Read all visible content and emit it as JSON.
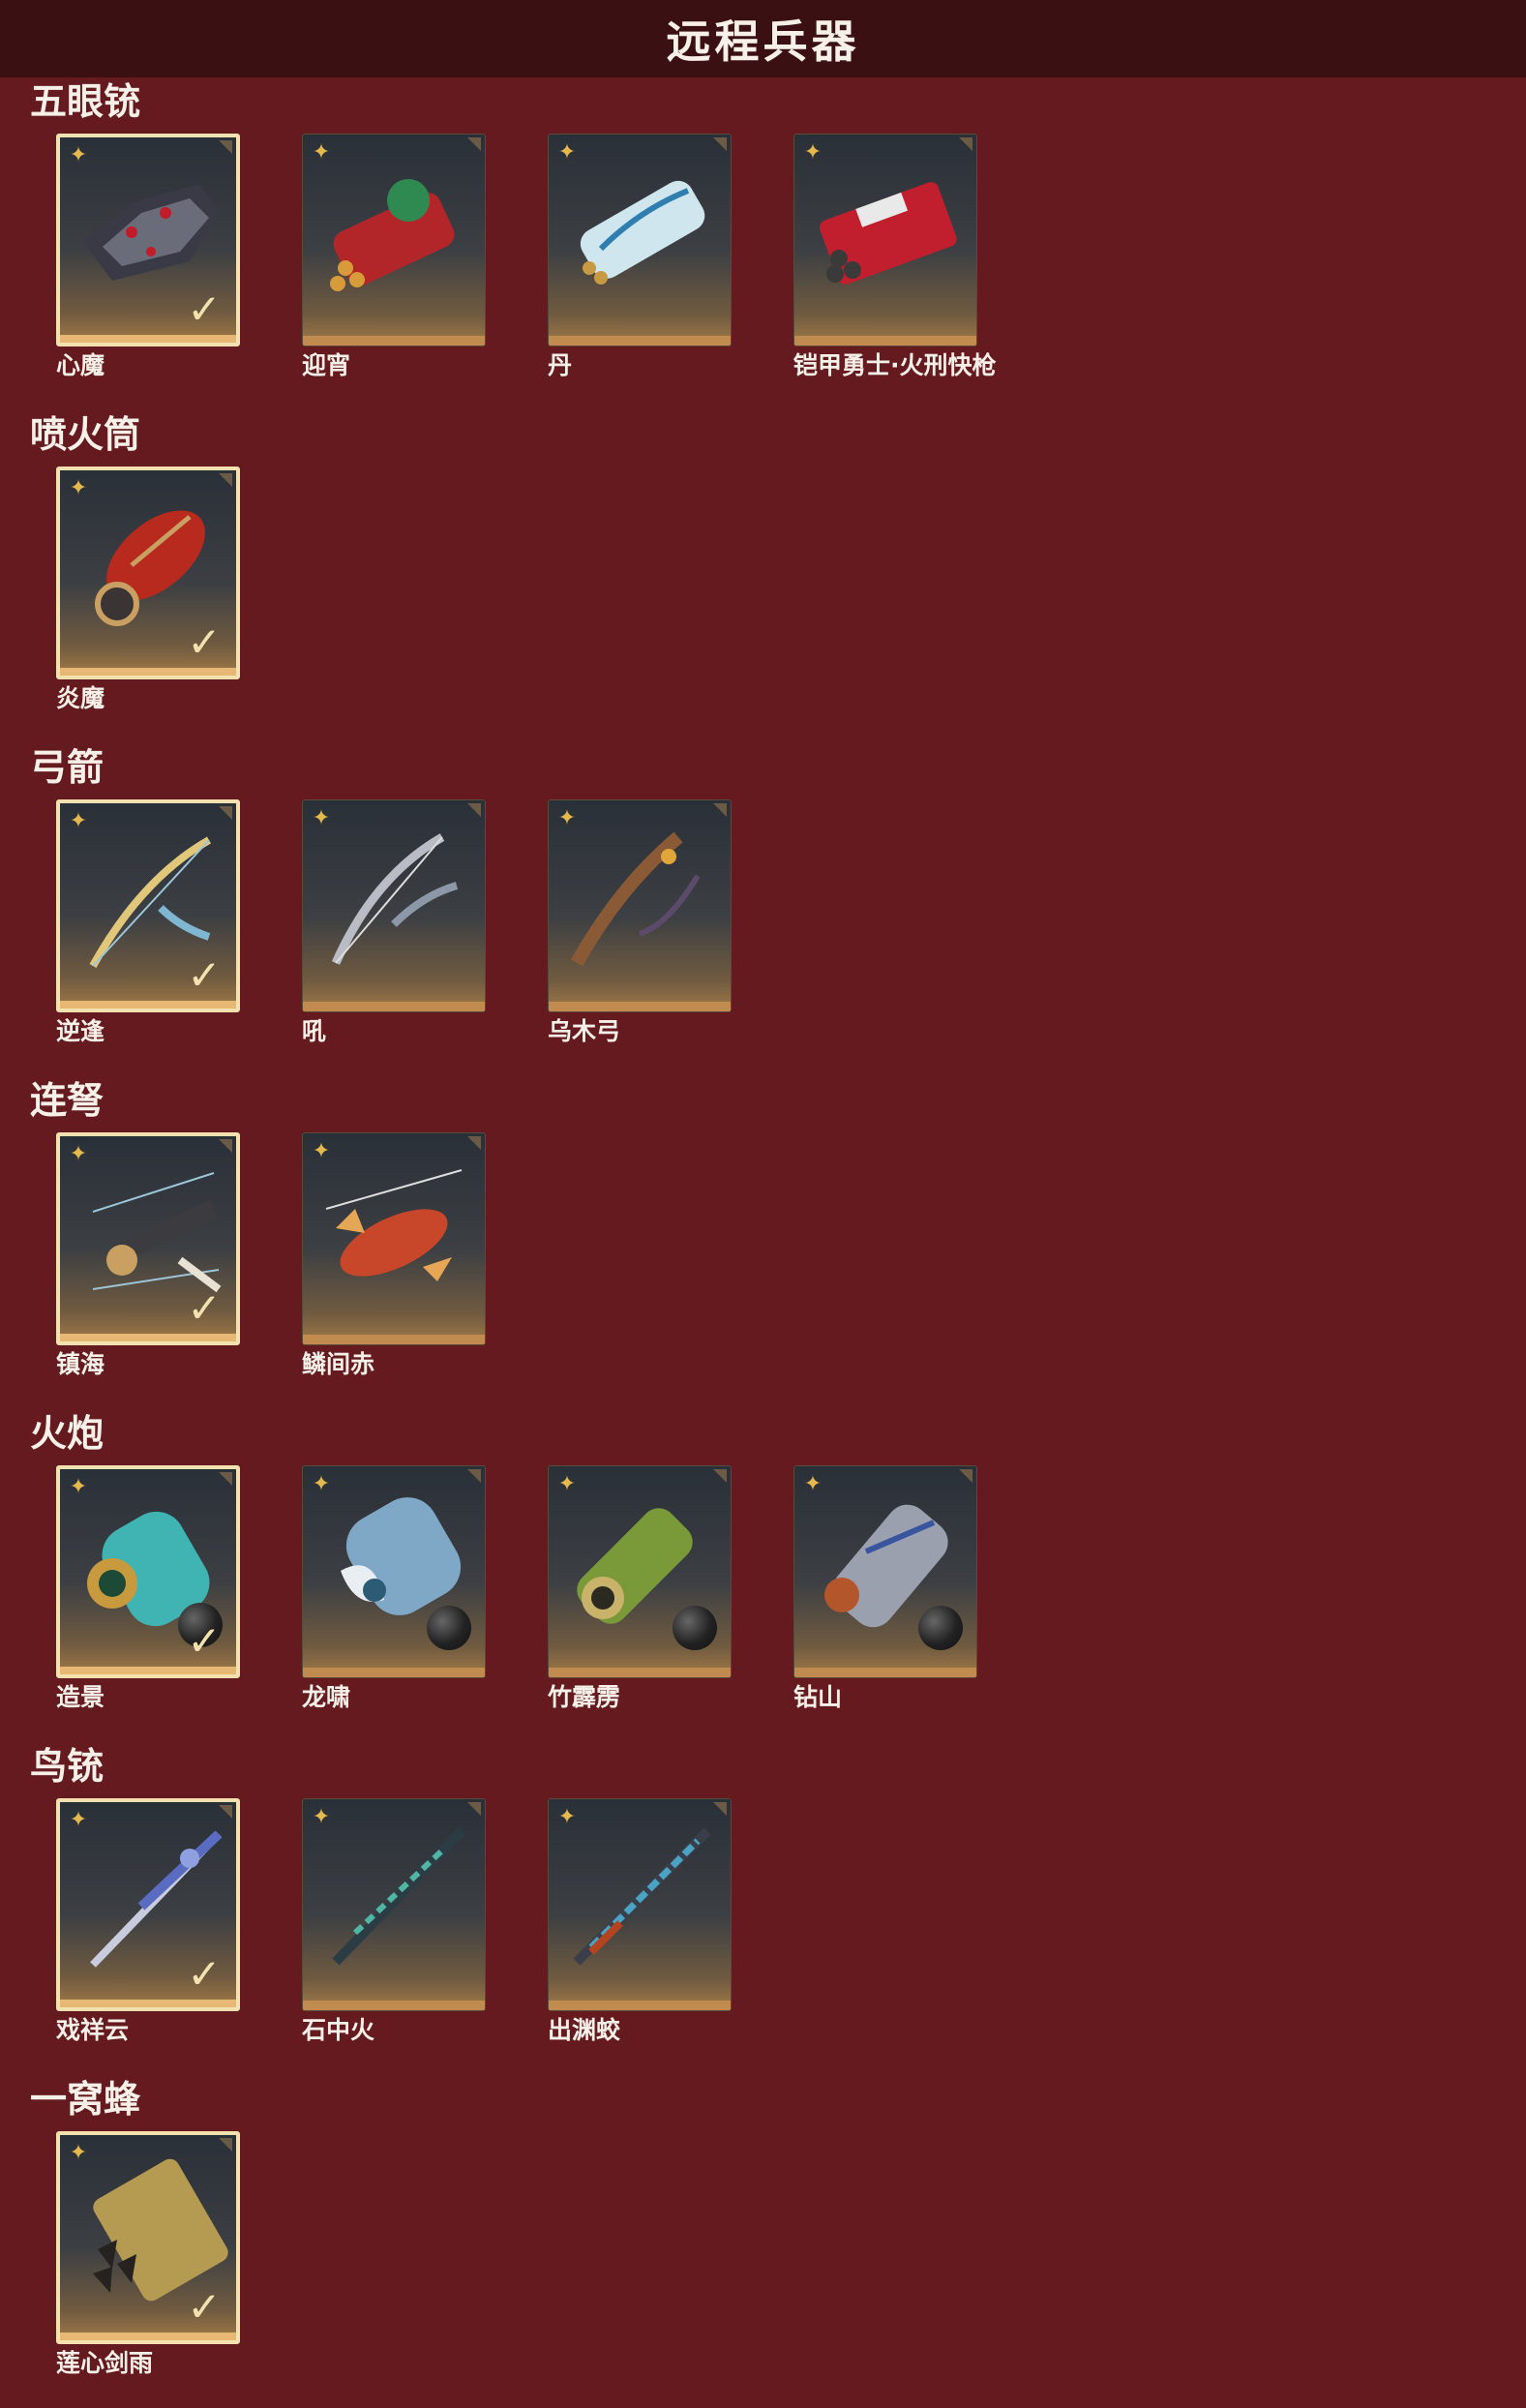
{
  "title": "远程兵器",
  "colors": {
    "background": "#641a1e",
    "topbar": "#3a1012",
    "selected_border": "#f3e2b0",
    "rank_icon": "#e6b94d"
  },
  "sections": [
    {
      "title": "五眼铳",
      "items": [
        {
          "name": "心魔",
          "selected": true,
          "icon": "dark-dragon-gun-icon"
        },
        {
          "name": "迎宵",
          "selected": false,
          "icon": "red-lion-gun-icon"
        },
        {
          "name": "丹",
          "selected": false,
          "icon": "white-crane-gun-icon"
        },
        {
          "name": "铠甲勇士·火刑快枪",
          "selected": false,
          "icon": "red-armor-gun-icon"
        }
      ]
    },
    {
      "title": "喷火筒",
      "items": [
        {
          "name": "炎魔",
          "selected": true,
          "icon": "flame-tube-icon"
        }
      ]
    },
    {
      "title": "弓箭",
      "items": [
        {
          "name": "逆逢",
          "selected": true,
          "icon": "golden-bow-icon"
        },
        {
          "name": "吼",
          "selected": false,
          "icon": "silver-bow-icon"
        },
        {
          "name": "乌木弓",
          "selected": false,
          "icon": "wooden-bow-icon"
        }
      ]
    },
    {
      "title": "连弩",
      "items": [
        {
          "name": "镇海",
          "selected": true,
          "icon": "crossbow-icon"
        },
        {
          "name": "鳞间赤",
          "selected": false,
          "icon": "fish-crossbow-icon"
        }
      ]
    },
    {
      "title": "火炮",
      "items": [
        {
          "name": "造景",
          "selected": true,
          "icon": "teal-cannon-icon"
        },
        {
          "name": "龙啸",
          "selected": false,
          "icon": "dragon-cannon-icon"
        },
        {
          "name": "竹霹雳",
          "selected": false,
          "icon": "bamboo-cannon-icon"
        },
        {
          "name": "钻山",
          "selected": false,
          "icon": "silver-cannon-icon"
        }
      ]
    },
    {
      "title": "鸟铳",
      "items": [
        {
          "name": "戏祥云",
          "selected": true,
          "icon": "cloud-musket-icon"
        },
        {
          "name": "石中火",
          "selected": false,
          "icon": "jade-musket-icon"
        },
        {
          "name": "出渊蛟",
          "selected": false,
          "icon": "dragon-musket-icon"
        }
      ]
    },
    {
      "title": "一窝蜂",
      "items": [
        {
          "name": "莲心剑雨",
          "selected": true,
          "icon": "golden-rocket-launcher-icon"
        }
      ]
    }
  ]
}
